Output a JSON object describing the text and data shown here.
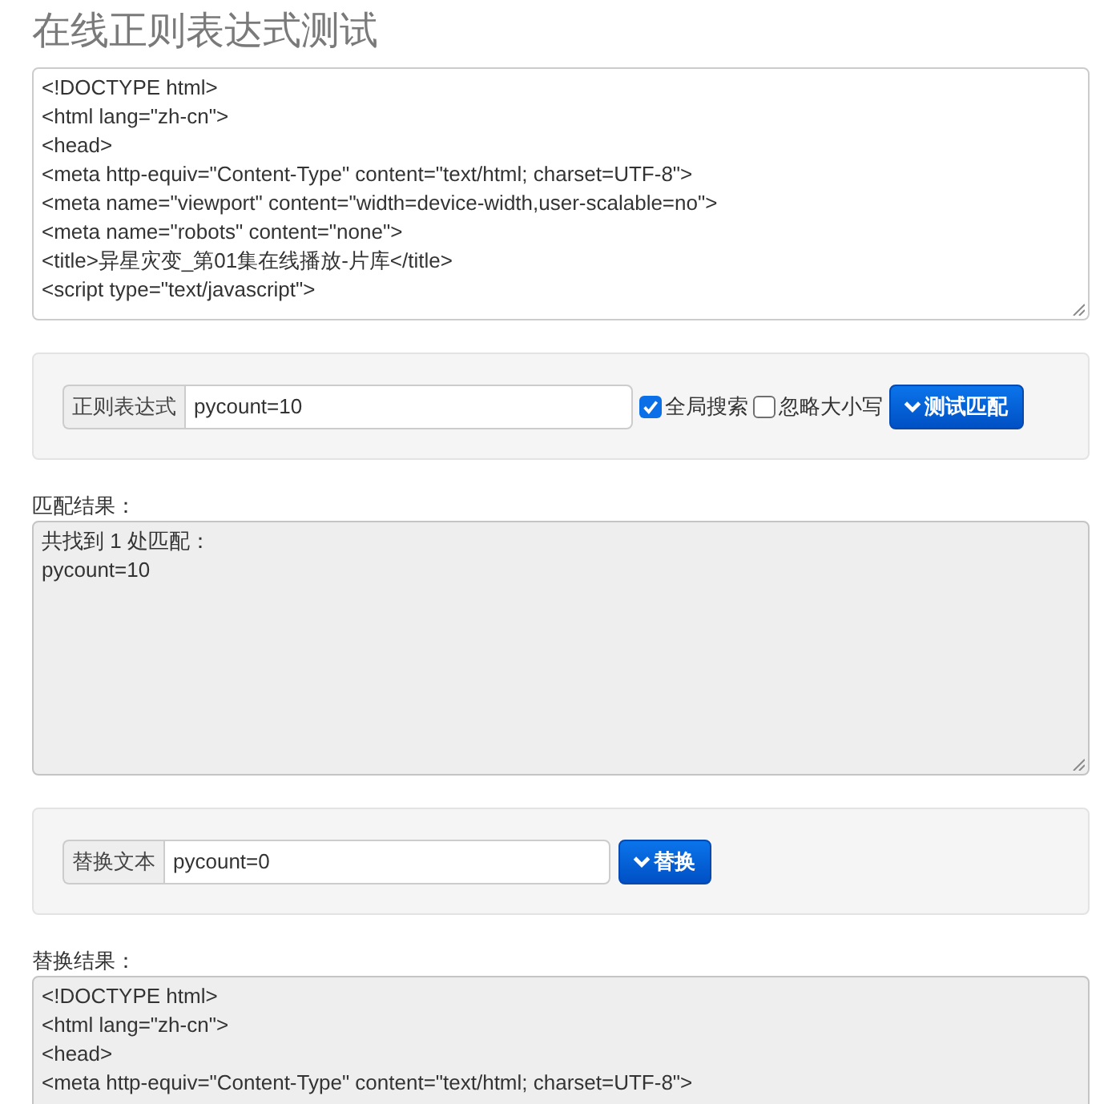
{
  "title": "在线正则表达式测试",
  "source_text": {
    "lines": [
      "<!DOCTYPE html>",
      "<html lang=\"zh-cn\">",
      "<head>",
      "<meta http-equiv=\"Content-Type\" content=\"text/html; charset=UTF-8\">",
      "<meta name=\"viewport\" content=\"width=device-width,user-scalable=no\">",
      "<meta name=\"robots\" content=\"none\">",
      "<title>异星灾变_第01集在线播放-片库</title>",
      "<script type=\"text/javascript\">"
    ]
  },
  "match_panel": {
    "field": {
      "label": "正则表达式",
      "value": "pycount=10"
    },
    "options": [
      {
        "label": "全局搜索",
        "checked": true
      },
      {
        "label": "忽略大小写",
        "checked": false
      }
    ],
    "button": {
      "label": "测试匹配"
    }
  },
  "match_result": {
    "label": "匹配结果：",
    "lines": [
      "共找到 1 处匹配：",
      "pycount=10"
    ]
  },
  "replace_panel": {
    "field": {
      "label": "替换文本",
      "value": "pycount=0"
    },
    "button": {
      "label": "替换"
    }
  },
  "replace_result": {
    "label": "替换结果：",
    "lines": [
      "<!DOCTYPE html>",
      "<html lang=\"zh-cn\">",
      "<head>",
      "<meta http-equiv=\"Content-Type\" content=\"text/html; charset=UTF-8\">"
    ]
  }
}
